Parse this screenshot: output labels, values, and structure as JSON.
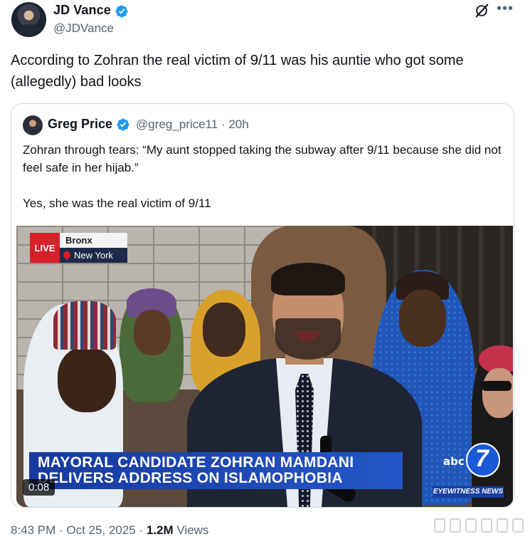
{
  "post": {
    "author_name": "JD Vance",
    "author_handle": "@JDVance",
    "text": "According to Zohran the real victim of 9/11 was his auntie who got some (allegedly) bad looks",
    "timestamp": "8:43 PM · Oct 25, 2025 · ",
    "views_count": "1.2M",
    "views_label": " Views"
  },
  "quote": {
    "author_name": "Greg Price",
    "author_handle": "@greg_price11 · 20h",
    "paragraph1": "Zohran through tears: “My aunt stopped taking the subway after 9/11 because she did not feel safe in her hijab.”",
    "paragraph2": "Yes, she was the real victim of 9/11"
  },
  "video": {
    "live_label": "LIVE",
    "location_top": "Bronx",
    "location_bottom": "New York",
    "headline_line1": "MAYORAL CANDIDATE ZOHRAN MAMDANI",
    "headline_line2": "DELIVERS ADDRESS ON ISLAMOPHOBIA",
    "station_text": "abc",
    "station_number": "7",
    "station_tagline": "EYEWITNESS NEWS",
    "duration": "0:08"
  },
  "icons": {
    "verified": "verified-badge-icon",
    "grok": "grok-icon",
    "more": "more-icon"
  },
  "colors": {
    "verified_blue": "#1d9bf0",
    "secondary_text": "#536471",
    "live_red": "#d91f2a",
    "banner_blue": "#1a3ea0"
  }
}
